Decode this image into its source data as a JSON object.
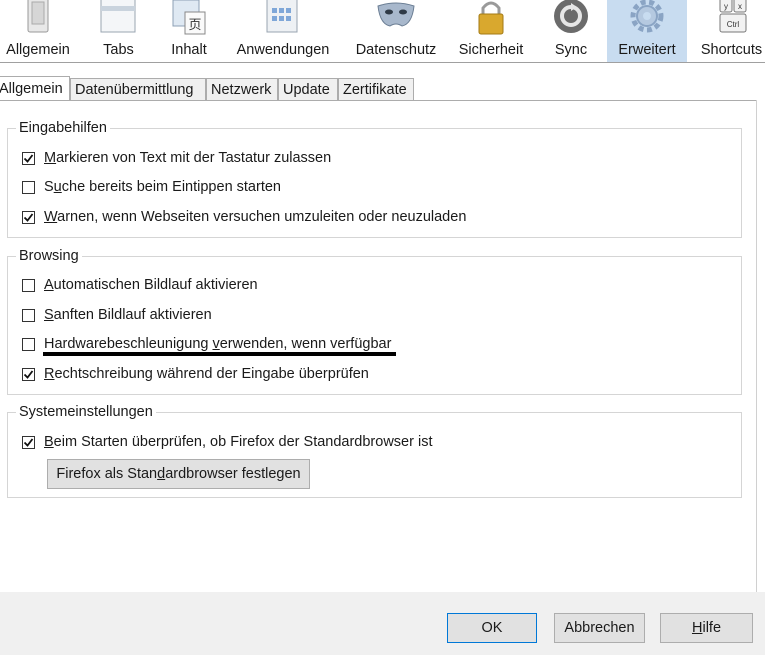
{
  "toolbar": {
    "items": [
      {
        "label": "Allgemein",
        "icon": "switch-icon"
      },
      {
        "label": "Tabs",
        "icon": "tabs-window-icon"
      },
      {
        "label": "Inhalt",
        "icon": "content-image-icon"
      },
      {
        "label": "Anwendungen",
        "icon": "applications-icon"
      },
      {
        "label": "Datenschutz",
        "icon": "mask-icon"
      },
      {
        "label": "Sicherheit",
        "icon": "padlock-icon"
      },
      {
        "label": "Sync",
        "icon": "sync-icon"
      },
      {
        "label": "Erweitert",
        "icon": "gear-icon"
      },
      {
        "label": "Shortcuts",
        "icon": "keyboard-keys-icon"
      }
    ],
    "active": "Erweitert"
  },
  "tabs": [
    {
      "label": "Allgemein",
      "active": true
    },
    {
      "label": "Datenübermittlung"
    },
    {
      "label": "Netzwerk"
    },
    {
      "label": "Update"
    },
    {
      "label": "Zertifikate"
    }
  ],
  "groups": {
    "eingabehilfen": {
      "title": "Eingabehilfen",
      "items": [
        {
          "accel": "M",
          "rest": "arkieren von Text mit der Tastatur zulassen",
          "checked": true
        },
        {
          "pre": "S",
          "accel": "u",
          "rest": "che bereits beim Eintippen starten",
          "checked": false
        },
        {
          "accel": "W",
          "rest": "arnen, wenn Webseiten versuchen umzuleiten oder neuzuladen",
          "checked": true
        }
      ]
    },
    "browsing": {
      "title": "Browsing",
      "items": [
        {
          "accel": "A",
          "rest": "utomatischen Bildlauf aktivieren",
          "checked": false
        },
        {
          "accel": "S",
          "rest": "anften Bildlauf aktivieren",
          "checked": false
        },
        {
          "pre": "Hardwarebeschleunigung ",
          "accel": "v",
          "rest": "erwenden, wenn verfügbar",
          "checked": false
        },
        {
          "accel": "R",
          "rest": "echtschreibung während der Eingabe überprüfen",
          "checked": true
        }
      ]
    },
    "system": {
      "title": "Systemeinstellungen",
      "items": [
        {
          "accel": "B",
          "rest": "eim Starten überprüfen, ob Firefox der Standardbrowser ist",
          "checked": true
        }
      ],
      "button": {
        "pre": "Firefox als Stan",
        "accel": "d",
        "rest": "ardbrowser festlegen"
      }
    }
  },
  "footer": {
    "ok": "OK",
    "cancel": "Abbrechen",
    "help_accel": "H",
    "help_rest": "ilfe"
  },
  "colors": {
    "active_toolbar_bg": "#c8dcf0",
    "default_button_border": "#0078d7"
  }
}
